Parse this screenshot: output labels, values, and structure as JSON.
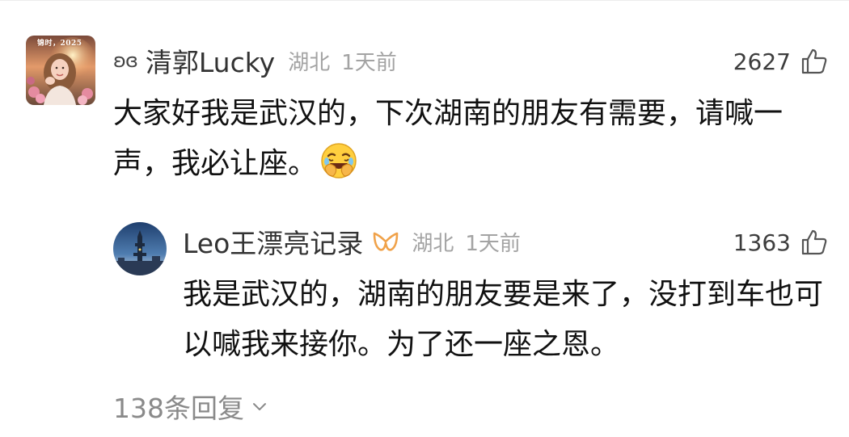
{
  "comment": {
    "user_prefix": "ʚɞ",
    "username": "清郭Lucky",
    "avatar_tag": "锦时，2025",
    "location": "湖北",
    "time": "1天前",
    "like_count": "2627",
    "body": "大家好我是武汉的，下次湖南的朋友有需要，请喊一声，我必让座。",
    "emoji": "face-with-hand-over-mouth-laughing-icon"
  },
  "reply": {
    "username": "Leo王漂亮记录",
    "badge": "verified-icon",
    "location": "湖北",
    "time": "1天前",
    "like_count": "1363",
    "body": "我是武汉的，湖南的朋友要是来了，没打到车也可以喊我来接你。为了还一座之恩。"
  },
  "replies_toggle": {
    "label": "138条回复"
  },
  "colors": {
    "text_primary": "#111111",
    "text_name": "#333333",
    "text_meta": "#a3a3a3",
    "text_secondary": "#8a8a8a",
    "badge_accent": "#f0a24a"
  }
}
